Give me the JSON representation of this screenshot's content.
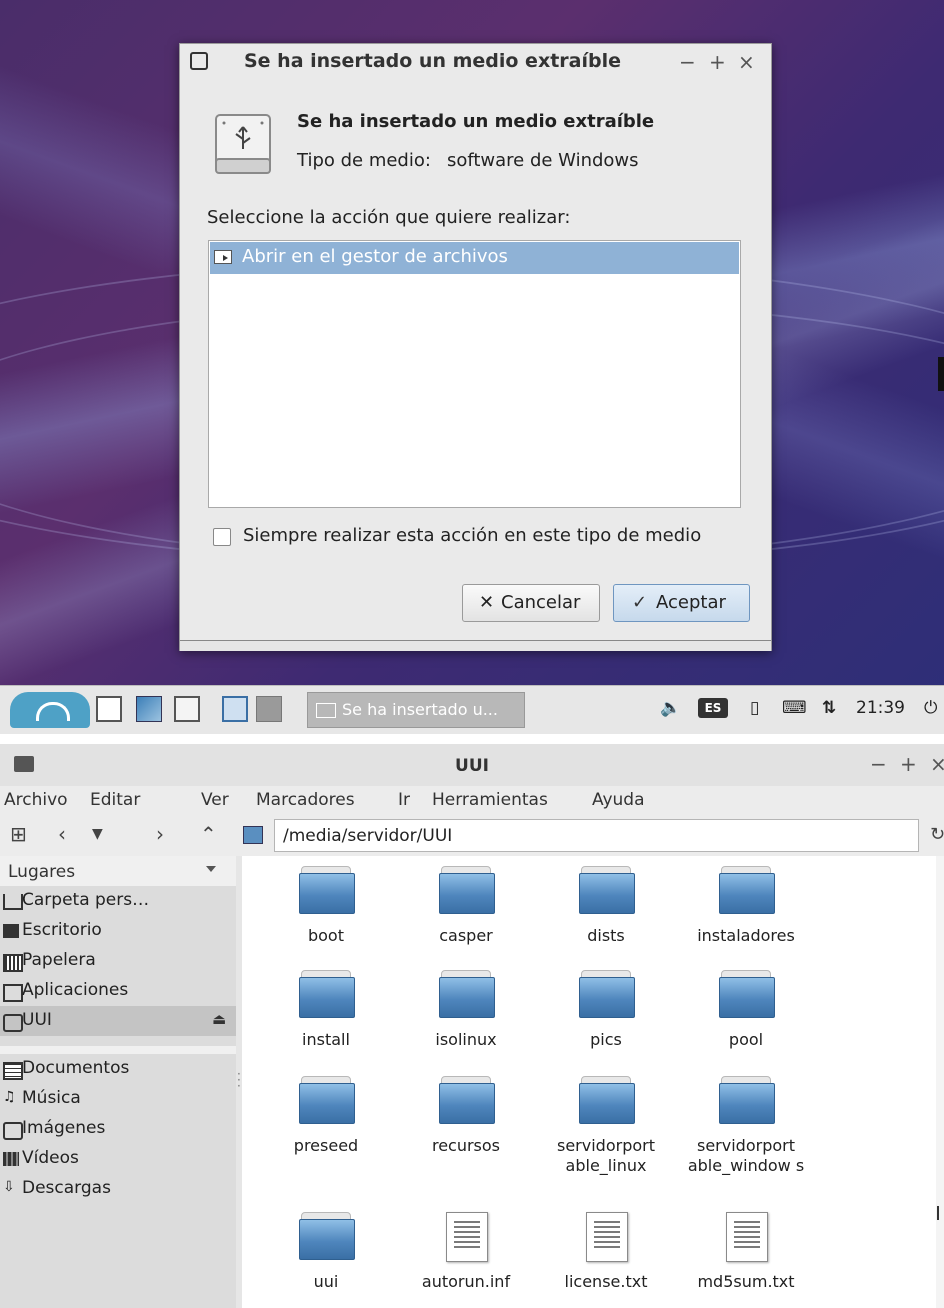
{
  "dialog": {
    "title": "Se ha insertado un medio extraíble",
    "controls": [
      "−",
      "+",
      "×"
    ],
    "heading": "Se ha insertado un medio extraíble",
    "media_type_label": "Tipo de medio:",
    "media_type_value": "software de Windows",
    "prompt": "Seleccione la acción que quiere realizar:",
    "actions": [
      "Abrir en el gestor de archivos"
    ],
    "always_checkbox": {
      "label": "Siempre realizar esta acción en este tipo de medio",
      "checked": false
    },
    "cancel_label": "Cancelar",
    "ok_label": "Aceptar"
  },
  "taskbar": {
    "task_label": "Se ha insertado u...",
    "keyboard_layout": "ES",
    "clock": "21:39"
  },
  "file_manager": {
    "title": "UUI",
    "controls": [
      "−",
      "+",
      "×"
    ],
    "menu": [
      "Archivo",
      "Editar",
      "Ver",
      "Marcadores",
      "Ir",
      "Herramientas",
      "Ayuda"
    ],
    "path": "/media/servidor/UUI",
    "sidebar_header": "Lugares",
    "places": [
      "Carpeta pers…",
      "Escritorio",
      "Papelera",
      "Aplicaciones",
      "UUI"
    ],
    "bookmarks": [
      "Documentos",
      "Música",
      "Imágenes",
      "Vídeos",
      "Descargas"
    ],
    "files": [
      {
        "name": "boot",
        "kind": "folder"
      },
      {
        "name": "casper",
        "kind": "folder"
      },
      {
        "name": "dists",
        "kind": "folder"
      },
      {
        "name": "instaladores",
        "kind": "folder"
      },
      {
        "name": "install",
        "kind": "folder"
      },
      {
        "name": "isolinux",
        "kind": "folder"
      },
      {
        "name": "pics",
        "kind": "folder"
      },
      {
        "name": "pool",
        "kind": "folder"
      },
      {
        "name": "preseed",
        "kind": "folder"
      },
      {
        "name": "recursos",
        "kind": "folder"
      },
      {
        "name": "servidorport able_linux",
        "kind": "folder"
      },
      {
        "name": "servidorport able_window s",
        "kind": "folder"
      },
      {
        "name": "uui",
        "kind": "folder"
      },
      {
        "name": "autorun.inf",
        "kind": "text"
      },
      {
        "name": "license.txt",
        "kind": "text"
      },
      {
        "name": "md5sum.txt",
        "kind": "text"
      }
    ]
  }
}
